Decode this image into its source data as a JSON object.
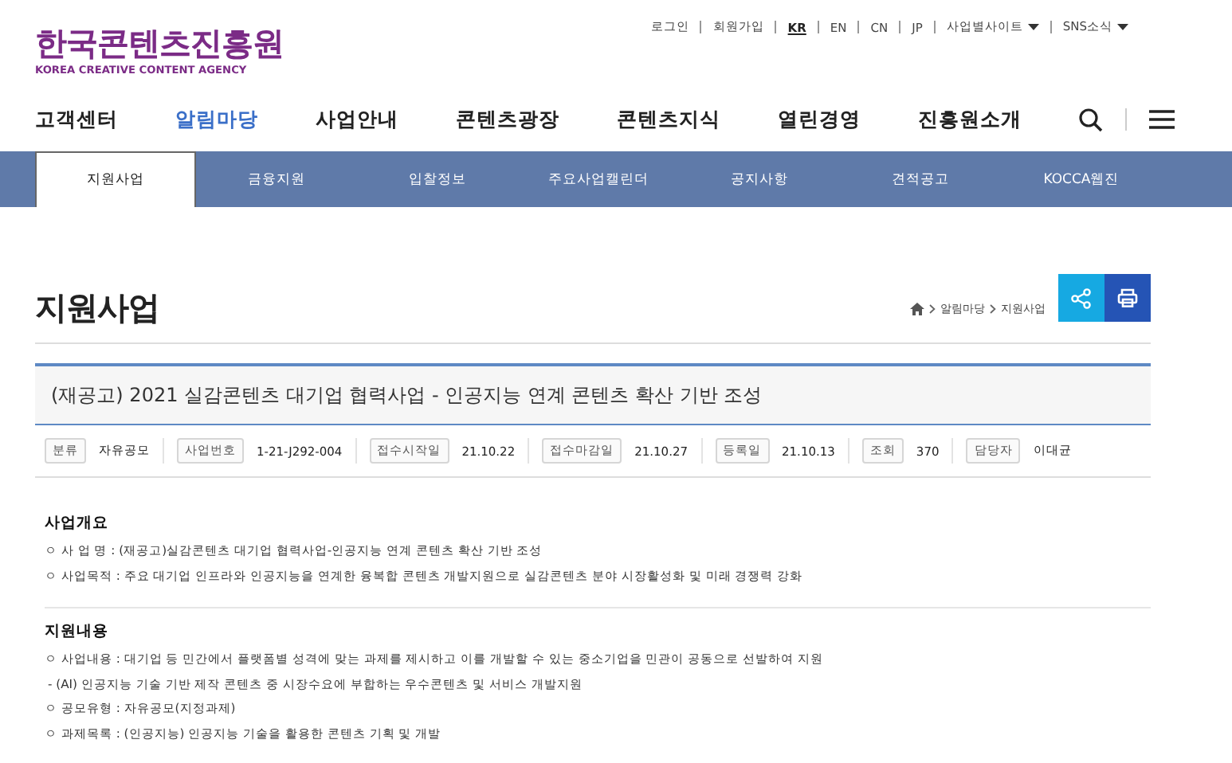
{
  "header": {
    "logo": {
      "name": "한국콘텐츠진흥원",
      "subtitle": "KOREA CREATIVE CONTENT AGENCY"
    },
    "util_links": [
      {
        "label": "로그인",
        "kind": "link",
        "selected": false
      },
      {
        "label": "회원가입",
        "kind": "link",
        "selected": false
      },
      {
        "label": "KR",
        "kind": "link",
        "selected": true
      },
      {
        "label": "EN",
        "kind": "link",
        "selected": false
      },
      {
        "label": "CN",
        "kind": "link",
        "selected": false
      },
      {
        "label": "JP",
        "kind": "link",
        "selected": false
      },
      {
        "label": "사업별사이트",
        "kind": "dropdown",
        "selected": false
      },
      {
        "label": "SNS소식",
        "kind": "dropdown",
        "selected": false
      }
    ],
    "nav": [
      {
        "label": "고객센터",
        "selected": false
      },
      {
        "label": "알림마당",
        "selected": true
      },
      {
        "label": "사업안내",
        "selected": false
      },
      {
        "label": "콘텐츠광장",
        "selected": false
      },
      {
        "label": "콘텐츠지식",
        "selected": false
      },
      {
        "label": "열린경영",
        "selected": false
      },
      {
        "label": "진흥원소개",
        "selected": false
      }
    ]
  },
  "subnav": [
    {
      "label": "지원사업",
      "selected": true
    },
    {
      "label": "금융지원",
      "selected": false
    },
    {
      "label": "입찰정보",
      "selected": false
    },
    {
      "label": "주요사업캘린더",
      "selected": false
    },
    {
      "label": "공지사항",
      "selected": false
    },
    {
      "label": "견적공고",
      "selected": false
    },
    {
      "label": "KOCCA웹진",
      "selected": false
    }
  ],
  "page": {
    "title": "지원사업",
    "breadcrumb": [
      "알림마당",
      "지원사업"
    ]
  },
  "post": {
    "title": "(재공고) 2021 실감콘텐츠 대기업 협력사업 - 인공지능 연계 콘텐츠 확산 기반 조성",
    "meta": [
      {
        "label": "분류",
        "value": "자유공모"
      },
      {
        "label": "사업번호",
        "value": "1-21-J292-004"
      },
      {
        "label": "접수시작일",
        "value": "21.10.22"
      },
      {
        "label": "접수마감일",
        "value": "21.10.27"
      },
      {
        "label": "등록일",
        "value": "21.10.13"
      },
      {
        "label": "조회",
        "value": "370"
      },
      {
        "label": "담당자",
        "value": "이대균"
      }
    ]
  },
  "sections": [
    {
      "heading": "사업개요",
      "lines": [
        {
          "kind": "bullet",
          "text": "ㅇ 사 업 명 : (재공고)실감콘텐츠 대기업 협력사업-인공지능 연계 콘텐츠 확산 기반 조성"
        },
        {
          "kind": "bullet",
          "text": "ㅇ 사업목적 : 주요 대기업 인프라와 인공지능을 연계한 융복합 콘텐츠 개발지원으로 실감콘텐츠 분야 시장활성화 및 미래 경쟁력 강화"
        }
      ]
    },
    {
      "heading": "지원내용",
      "lines": [
        {
          "kind": "bullet",
          "text": "ㅇ 사업내용 : 대기업 등 민간에서 플랫폼별 성격에 맞는 과제를 제시하고 이를 개발할 수 있는 중소기업을 민관이 공동으로 선발하여 지원"
        },
        {
          "kind": "dash",
          "text": "- (AI) 인공지능 기술 기반 제작 콘텐츠 중 시장수요에 부합하는 우수콘텐츠 및 서비스 개발지원"
        },
        {
          "kind": "bullet",
          "text": "ㅇ 공모유형 : 자유공모(지정과제)"
        },
        {
          "kind": "bullet",
          "text": "ㅇ 과제목록 : (인공지능) 인공지능 기술을 활용한 콘텐츠 기획 및 개발"
        }
      ]
    }
  ]
}
